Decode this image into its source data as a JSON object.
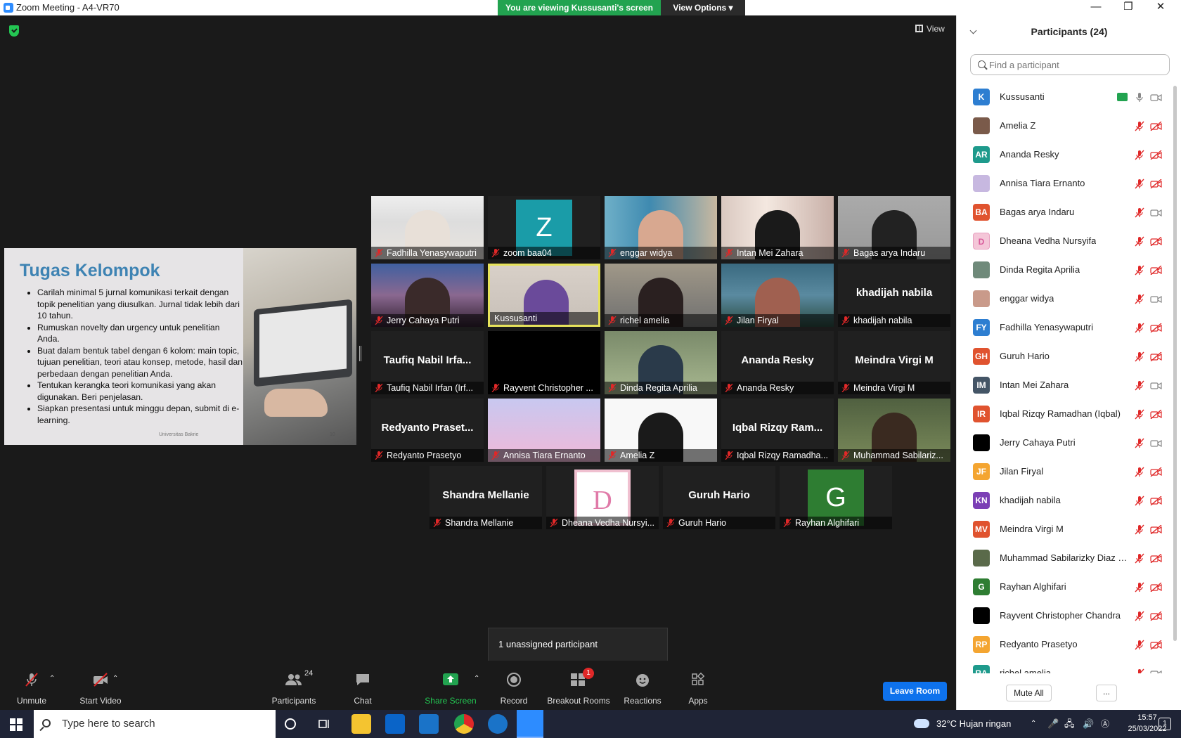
{
  "window": {
    "title": "Zoom Meeting - A4-VR70",
    "minimize": "—",
    "maximize": "❐",
    "close": "✕"
  },
  "share_banner": {
    "text": "You are viewing Kussusanti's screen",
    "view_options": "View Options ▾"
  },
  "view_button": "View",
  "slide": {
    "title": "Tugas Kelompok",
    "bullets": [
      "Carilah minimal 5 jurnal komunikasi  terkait dengan topik penelitian yang diusulkan. Jurnal tidak lebih dari 10 tahun.",
      "Rumuskan novelty dan urgency untuk penelitian Anda.",
      "Buat dalam bentuk tabel dengan 6 kolom: main topic, tujuan penelitian, teori atau konsep, metode, hasil dan perbedaan dengan penelitian Anda.",
      "Tentukan kerangka teori komunikasi yang akan digunakan. Beri penjelasan.",
      "Siapkan presentasi untuk minggu depan, submit di e-learning."
    ],
    "footer": "Universitas Bakrie",
    "page": "10"
  },
  "tiles": [
    {
      "label": "Fadhilla Yenasywaputri",
      "muted": true
    },
    {
      "label": "zoom baa04",
      "avatar": "Z",
      "muted": true
    },
    {
      "label": "enggar widya",
      "muted": true
    },
    {
      "label": "Intan Mei Zahara",
      "muted": true
    },
    {
      "label": "Bagas arya Indaru",
      "muted": true
    },
    {
      "label": "Jerry Cahaya Putri",
      "muted": true
    },
    {
      "label": "Kussusanti",
      "muted": false
    },
    {
      "label": "richel amelia",
      "muted": true
    },
    {
      "label": "Jilan Firyal",
      "muted": true
    },
    {
      "label": "khadijah nabila",
      "big": "khadijah nabila",
      "muted": true
    },
    {
      "label": "Taufiq Nabil Irfan (Irf...",
      "big": "Taufiq Nabil Irfa...",
      "muted": true
    },
    {
      "label": "Rayvent Christopher ...",
      "muted": true
    },
    {
      "label": "Dinda Regita Aprilia",
      "muted": true
    },
    {
      "label": "Ananda Resky",
      "big": "Ananda Resky",
      "muted": true
    },
    {
      "label": "Meindra Virgi M",
      "big": "Meindra Virgi M",
      "muted": true
    },
    {
      "label": "Redyanto Prasetyo",
      "big": "Redyanto Praset...",
      "muted": true
    },
    {
      "label": "Annisa Tiara Ernanto",
      "muted": true
    },
    {
      "label": "Amelia Z",
      "muted": true
    },
    {
      "label": "Iqbal Rizqy Ramadha...",
      "big": "Iqbal Rizqy Ram...",
      "muted": true
    },
    {
      "label": "Muhammad Sabilariz...",
      "muted": true
    },
    {
      "label": "Shandra Mellanie",
      "big": "Shandra Mellanie",
      "muted": true
    },
    {
      "label": "Dheana Vedha Nursyi...",
      "avatar": "D",
      "muted": true
    },
    {
      "label": "Guruh Hario",
      "big": "Guruh Hario",
      "muted": true
    },
    {
      "label": "Rayhan Alghifari",
      "avatar": "G",
      "muted": true
    }
  ],
  "unassigned": "1 unassigned participant",
  "toolbar": {
    "unmute": "Unmute",
    "start_video": "Start Video",
    "participants": "Participants",
    "participants_count": "24",
    "chat": "Chat",
    "share_screen": "Share Screen",
    "record": "Record",
    "breakout_rooms": "Breakout Rooms",
    "breakout_badge": "1",
    "reactions": "Reactions",
    "apps": "Apps",
    "leave": "Leave Room"
  },
  "panel": {
    "header": "Participants (24)",
    "search_placeholder": "Find a participant",
    "mute_all": "Mute All",
    "more": "...",
    "participants": [
      {
        "name": "Kussusanti",
        "initials": "K",
        "color": "#2d7ed1",
        "host": true
      },
      {
        "name": "Amelia Z",
        "initials": "",
        "color": "#7a5a4a"
      },
      {
        "name": "Ananda Resky",
        "initials": "AR",
        "color": "#1e9a8c"
      },
      {
        "name": "Annisa Tiara Ernanto",
        "initials": "",
        "color": "#c7b8e0"
      },
      {
        "name": "Bagas arya Indaru",
        "initials": "BA",
        "color": "#e0532f"
      },
      {
        "name": "Dheana Vedha Nursyifa",
        "initials": "D",
        "color": "#f4c6d8"
      },
      {
        "name": "Dinda Regita Aprilia",
        "initials": "",
        "color": "#6f8a7a"
      },
      {
        "name": "enggar widya",
        "initials": "",
        "color": "#c99a8a"
      },
      {
        "name": "Fadhilla Yenasywaputri",
        "initials": "FY",
        "color": "#2d7ed1"
      },
      {
        "name": "Guruh Hario",
        "initials": "GH",
        "color": "#e0532f"
      },
      {
        "name": "Intan Mei Zahara",
        "initials": "IM",
        "color": "#445566"
      },
      {
        "name": "Iqbal Rizqy Ramadhan (Iqbal)",
        "initials": "IR",
        "color": "#e0532f"
      },
      {
        "name": "Jerry Cahaya Putri",
        "initials": "",
        "color": "#000000"
      },
      {
        "name": "Jilan Firyal",
        "initials": "JF",
        "color": "#f4a531"
      },
      {
        "name": "khadijah nabila",
        "initials": "KN",
        "color": "#7b3fb5"
      },
      {
        "name": "Meindra Virgi M",
        "initials": "MV",
        "color": "#e0532f"
      },
      {
        "name": "Muhammad Sabilarizky Diaz Pu...",
        "initials": "",
        "color": "#5a6a4a"
      },
      {
        "name": "Rayhan Alghifari",
        "initials": "G",
        "color": "#2e7d32"
      },
      {
        "name": "Rayvent Christopher Chandra",
        "initials": "",
        "color": "#000000"
      },
      {
        "name": "Redyanto Prasetyo",
        "initials": "RP",
        "color": "#f4a531"
      },
      {
        "name": "richel amelia",
        "initials": "RA",
        "color": "#1e9a8c"
      }
    ]
  },
  "taskbar": {
    "search_placeholder": "Type here to search",
    "weather": "32°C  Hujan ringan",
    "time": "15:57",
    "date": "25/03/2022",
    "notif": "1"
  }
}
